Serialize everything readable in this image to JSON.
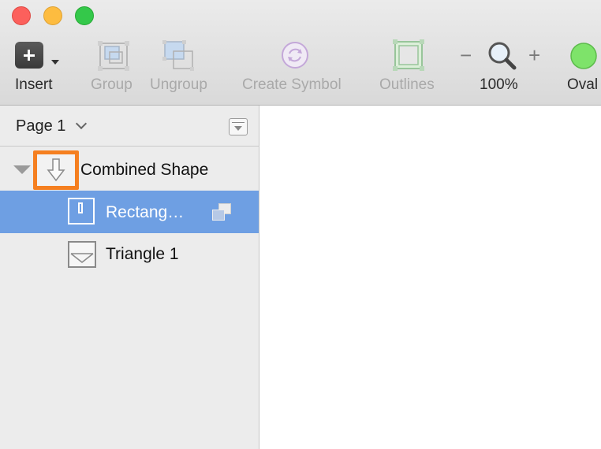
{
  "window": {
    "traffic_lights": [
      "close",
      "minimize",
      "maximize"
    ]
  },
  "toolbar": {
    "insert": {
      "label": "Insert",
      "icon": "plus-icon"
    },
    "group": {
      "label": "Group",
      "icon": "group-icon"
    },
    "ungroup": {
      "label": "Ungroup",
      "icon": "ungroup-icon"
    },
    "create_symbol": {
      "label": "Create Symbol",
      "icon": "symbol-icon"
    },
    "outlines": {
      "label": "Outlines",
      "icon": "outlines-icon"
    },
    "zoom": {
      "value": "100%",
      "minus": "−",
      "plus": "+"
    },
    "oval": {
      "label": "Oval",
      "icon": "oval-icon"
    }
  },
  "sidebar": {
    "page": {
      "label": "Page 1"
    },
    "layers": [
      {
        "name": "Combined Shape",
        "icon": "combined-shape-icon",
        "expanded": true
      },
      {
        "name": "Rectang…",
        "icon": "rectangle-icon",
        "selected": true,
        "badge": "boolean-union-icon"
      },
      {
        "name": "Triangle 1",
        "icon": "triangle-icon"
      }
    ]
  },
  "colors": {
    "selection": "#6e9fe3",
    "highlight_box": "#f57f20",
    "oval_fill": "#7ee36a"
  }
}
